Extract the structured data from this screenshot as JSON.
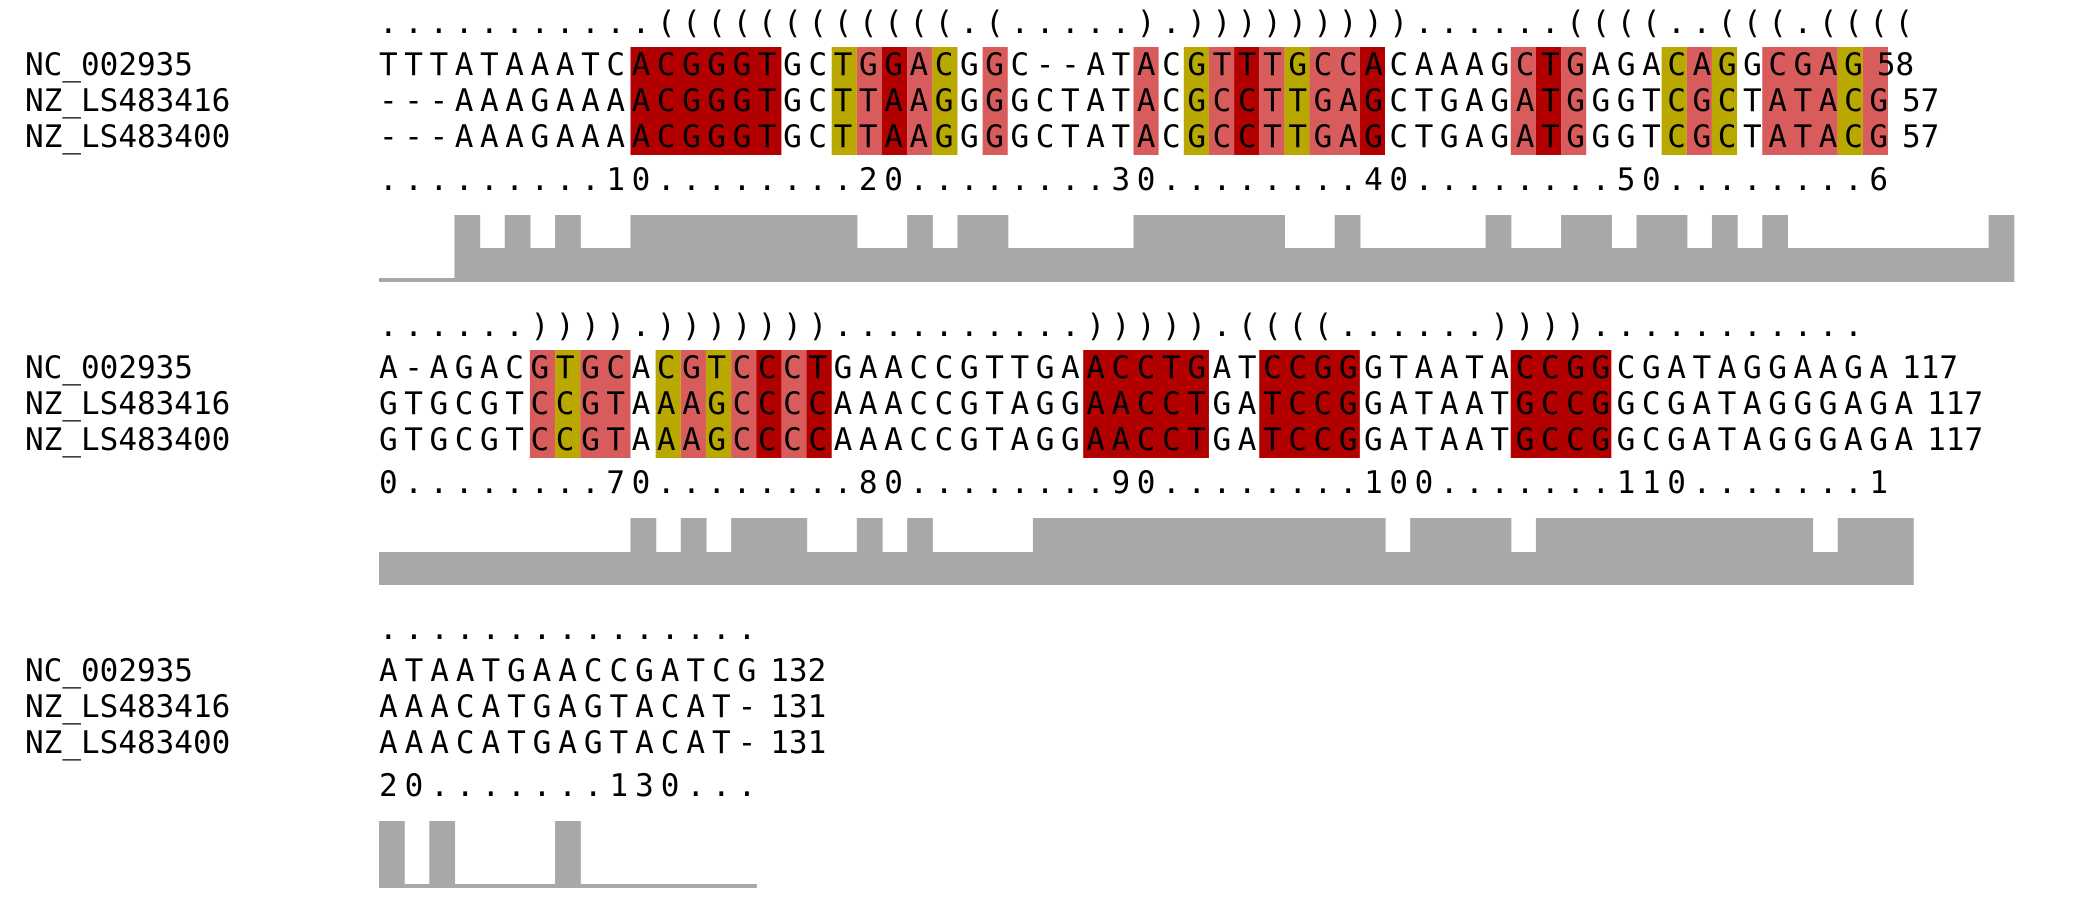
{
  "colors": {
    "dark_red": "#b20000",
    "light_red": "#d95c5c",
    "olive": "#b8a800",
    "conservation": "#a8a8a8",
    "text": "#000000"
  },
  "blocks": [
    {
      "structure": "...........((((((((((((.(.....).)))))))))......((((..(((.((((",
      "rows": [
        {
          "name": "NC_002935",
          "seq": "TTTATAAATCACGGGTGCTGGACGGC--ATACGTTTGCCACAAAGCTGAGACAGGCGAG",
          "end": "58"
        },
        {
          "name": "NZ_LS483416",
          "seq": "---AAAGAAAACGGGTGCTTAAGGGGCTATACGCCTTGAGCTGAGATGGGTCGCTATACG",
          "end": "57"
        },
        {
          "name": "NZ_LS483400",
          "seq": "---AAAGAAAACGGGTGCTTAAGGGGCTATACGCCTTGAGCTGAGATGGGTCGCTATACG",
          "end": "57"
        }
      ],
      "ruler": ".........10........20........30........40........50........6",
      "cols": [
        {
          "c": "d",
          "s": 11,
          "e": 16
        },
        {
          "c": "o",
          "s": 19,
          "e": 19
        },
        {
          "c": "l",
          "s": 20,
          "e": 20
        },
        {
          "c": "d",
          "s": 21,
          "e": 21
        },
        {
          "c": "l",
          "s": 22,
          "e": 22
        },
        {
          "c": "o",
          "s": 23,
          "e": 23
        },
        {
          "c": "l",
          "s": 25,
          "e": 25
        },
        {
          "c": "l",
          "s": 31,
          "e": 31
        },
        {
          "c": "o",
          "s": 33,
          "e": 33
        },
        {
          "c": "l",
          "s": 34,
          "e": 34
        },
        {
          "c": "d",
          "s": 35,
          "e": 35
        },
        {
          "c": "l",
          "s": 36,
          "e": 36
        },
        {
          "c": "o",
          "s": 37,
          "e": 37
        },
        {
          "c": "l",
          "s": 38,
          "e": 39
        },
        {
          "c": "d",
          "s": 40,
          "e": 40
        },
        {
          "c": "l",
          "s": 46,
          "e": 46
        },
        {
          "c": "d",
          "s": 47,
          "e": 47
        },
        {
          "c": "l",
          "s": 48,
          "e": 48
        },
        {
          "c": "o",
          "s": 52,
          "e": 52
        },
        {
          "c": "l",
          "s": 53,
          "e": 53
        },
        {
          "c": "o",
          "s": 54,
          "e": 54
        },
        {
          "c": "l",
          "s": 56,
          "e": 58
        },
        {
          "c": "o",
          "s": 59,
          "e": 59
        },
        {
          "c": "l",
          "s": 60,
          "e": 60
        }
      ],
      "conservation": [
        0,
        0,
        0,
        1,
        0.5,
        1,
        0.5,
        1,
        0.5,
        0.5,
        1,
        1,
        1,
        1,
        1,
        1,
        1,
        1,
        1,
        0.5,
        0.5,
        1,
        0.5,
        1,
        1,
        0.5,
        0.5,
        0.5,
        0.5,
        0.5,
        1,
        1,
        1,
        1,
        1,
        1,
        0.5,
        0.5,
        1,
        0.5,
        0.5,
        0.5,
        0.5,
        0.5,
        1,
        0.5,
        0.5,
        1,
        1,
        0.5,
        1,
        1,
        0.5,
        1,
        0.5,
        1,
        0.5,
        0.5,
        0.5,
        0.5,
        0.5,
        0.5,
        0.5,
        0.5,
        1
      ]
    },
    {
      "structure": "......)))).)))))))..........))))).((((......))))...........",
      "rows": [
        {
          "name": "NC_002935",
          "seq": "A-AGACGTGCACGTCCCTGAACCGTTGAACCTGATCCGGGTAATACCGGCGATAGGAAGA",
          "end": "117"
        },
        {
          "name": "NZ_LS483416",
          "seq": "GTGCGTCCGTAAAGCCCCAAACCGTAGGAACCTGATCCGGATAATGCCGGCGATAGGGAGA",
          "end": "117"
        },
        {
          "name": "NZ_LS483400",
          "seq": "GTGCGTCCGTAAAGCCCCAAACCGTAGGAACCTGATCCGGATAATGCCGGCGATAGGGAGA",
          "end": "117"
        }
      ],
      "ruler": "0........70........80........90........100.......110.......1",
      "cols": [
        {
          "c": "l",
          "s": 7,
          "e": 7
        },
        {
          "c": "o",
          "s": 8,
          "e": 8
        },
        {
          "c": "l",
          "s": 9,
          "e": 10
        },
        {
          "c": "o",
          "s": 12,
          "e": 12
        },
        {
          "c": "l",
          "s": 13,
          "e": 13
        },
        {
          "c": "o",
          "s": 14,
          "e": 14
        },
        {
          "c": "l",
          "s": 15,
          "e": 15
        },
        {
          "c": "l",
          "s": 17,
          "e": 17
        },
        {
          "c": "d",
          "s": 16,
          "e": 16
        },
        {
          "c": "d",
          "s": 18,
          "e": 18
        },
        {
          "c": "d",
          "s": 29,
          "e": 33
        },
        {
          "c": "d",
          "s": 36,
          "e": 39
        },
        {
          "c": "d",
          "s": 46,
          "e": 49
        }
      ],
      "conservation": [
        0,
        0,
        0,
        0,
        0,
        0,
        0,
        0,
        0,
        0,
        1,
        0,
        1,
        0,
        1,
        1,
        1,
        0,
        0,
        1,
        0,
        1,
        0,
        0,
        0,
        0,
        1,
        1,
        1,
        1,
        1,
        1,
        1,
        1,
        1,
        1,
        1,
        1,
        1,
        1,
        0,
        1,
        1,
        1,
        1,
        0,
        1,
        1,
        1,
        1,
        1,
        1,
        1,
        1,
        1,
        1,
        1,
        0,
        1,
        1,
        1
      ]
    },
    {
      "structure": "...............",
      "rows": [
        {
          "name": "NC_002935",
          "seq": "ATAATGAACCGATCG",
          "end": "132"
        },
        {
          "name": "NZ_LS483416",
          "seq": "AAACATGAGTACAT-",
          "end": "131"
        },
        {
          "name": "NZ_LS483400",
          "seq": "AAACATGAGTACAT-",
          "end": "131"
        }
      ],
      "ruler": "20.......130...",
      "cols": [],
      "conservation": [
        1,
        0,
        1,
        0,
        0,
        0,
        0,
        1,
        0,
        0,
        0,
        0,
        0,
        0,
        -1
      ]
    }
  ]
}
